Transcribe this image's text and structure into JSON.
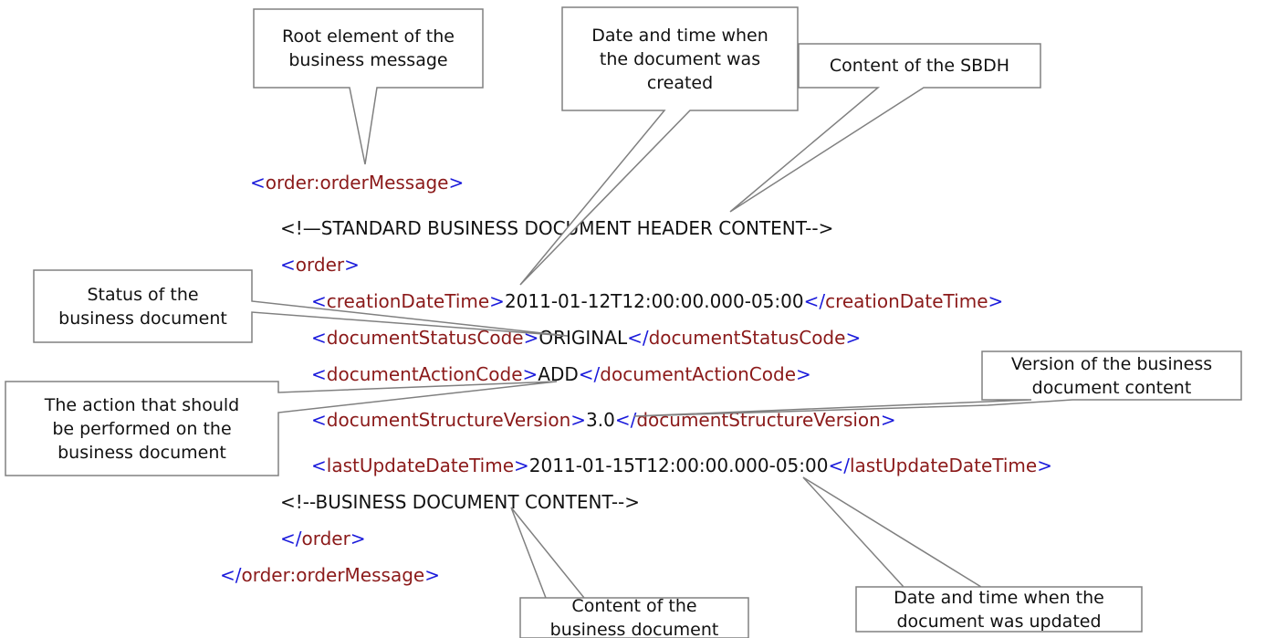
{
  "xml": {
    "order_message_open": {
      "open_bracket": "<",
      "tag": "order:orderMessage",
      "close_bracket": ">"
    },
    "sbdh_comment": "<!—STANDARD BUSINESS DOCUMENT HEADER CONTENT-->",
    "order_open": {
      "open_bracket": "<",
      "tag": "order",
      "close_bracket": ">"
    },
    "creation_date_time": {
      "open_bracket": "<",
      "tag": "creationDateTime",
      "close_bracket": ">",
      "value": "2011-01-12T12:00:00.000-05:00",
      "end_open": "</",
      "end_tag": "creationDateTime",
      "end_close": ">"
    },
    "document_status_code": {
      "open_bracket": "<",
      "tag": "documentStatusCode",
      "close_bracket": ">",
      "value": "ORIGINAL",
      "end_open": "</",
      "end_tag": "documentStatusCode",
      "end_close": ">"
    },
    "document_action_code": {
      "open_bracket": "<",
      "tag": "documentActionCode",
      "close_bracket": ">",
      "value": "ADD",
      "end_open": "</",
      "end_tag": "documentActionCode",
      "end_close": ">"
    },
    "document_structure_version": {
      "open_bracket": "<",
      "tag": "documentStructureVersion",
      "close_bracket": ">",
      "value": "3.0",
      "end_open": "</",
      "end_tag": "documentStructureVersion",
      "end_close": ">"
    },
    "last_update_date_time": {
      "open_bracket": "<",
      "tag": "lastUpdateDateTime",
      "close_bracket": ">",
      "value": "2011-01-15T12:00:00.000-05:00",
      "end_open": "</",
      "end_tag": "lastUpdateDateTime",
      "end_close": ">"
    },
    "business_comment": "<!--BUSINESS DOCUMENT CONTENT-->",
    "order_close": {
      "open_bracket": "</",
      "tag": "order",
      "close_bracket": ">"
    },
    "order_message_close": {
      "open_bracket": "</",
      "tag": "order:orderMessage",
      "close_bracket": ">"
    }
  },
  "callouts": {
    "root_element": "Root element of the\nbusiness message",
    "creation_date": "Date and time when\nthe document was\ncreated",
    "sbdh_content": "Content of the SBDH",
    "status": "Status of the\nbusiness document",
    "action": "The action that should\nbe performed on the\nbusiness document",
    "version": "Version of the business\ndocument content",
    "business_content": "Content of the\nbusiness document",
    "update_date": "Date and time when the\ndocument was updated"
  },
  "colors": {
    "bracket": "#1a1adb",
    "tag_name": "#8b1a1a",
    "text": "#111111",
    "callout_border": "#808080",
    "callout_fill": "#ffffff"
  }
}
